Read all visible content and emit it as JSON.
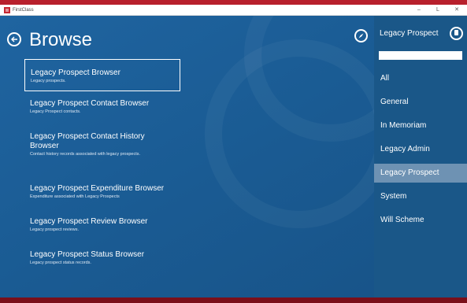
{
  "window": {
    "app_title": "FirstClass",
    "minimize_glyph": "–",
    "maximize_glyph": "L",
    "close_glyph": "✕"
  },
  "header": {
    "title": "Browse",
    "back_icon": "back-arrow-circle-icon",
    "compass_icon": "compass-icon"
  },
  "browsers": [
    {
      "title": "Legacy Prospect Browser",
      "description": "Legacy prospects.",
      "selected": true
    },
    {
      "title": "Legacy Prospect Contact Browser",
      "description": "Legacy Prospect contacts."
    },
    {
      "title": "Legacy Prospect Contact History Browser",
      "description": "Contact history records associated with legacy prospects."
    },
    {
      "title": "Legacy Prospect Expenditure Browser",
      "description": "Expenditure associated with Legacy Prospects"
    },
    {
      "title": "Legacy Prospect Review Browser",
      "description": "Legacy prospect reviews."
    },
    {
      "title": "Legacy Prospect Status Browser",
      "description": "Legacy prospect status records."
    }
  ],
  "panel": {
    "title": "Legacy Prospect",
    "pin_icon": "pin-icon",
    "search_value": "",
    "filters": [
      {
        "label": "All"
      },
      {
        "label": "General"
      },
      {
        "label": "In Memoriam"
      },
      {
        "label": "Legacy Admin"
      },
      {
        "label": "Legacy Prospect",
        "active": true
      },
      {
        "label": "System"
      },
      {
        "label": "Will Scheme"
      }
    ]
  },
  "statusbar": {
    "segments": [
      "",
      "",
      "",
      ""
    ]
  },
  "colors": {
    "main_bg": "#1b5a8f",
    "panel_bg": "#1a5788",
    "active_filter": "#6e92b3",
    "status_bar": "#7a0f1a",
    "brand_red": "#b8202c"
  }
}
